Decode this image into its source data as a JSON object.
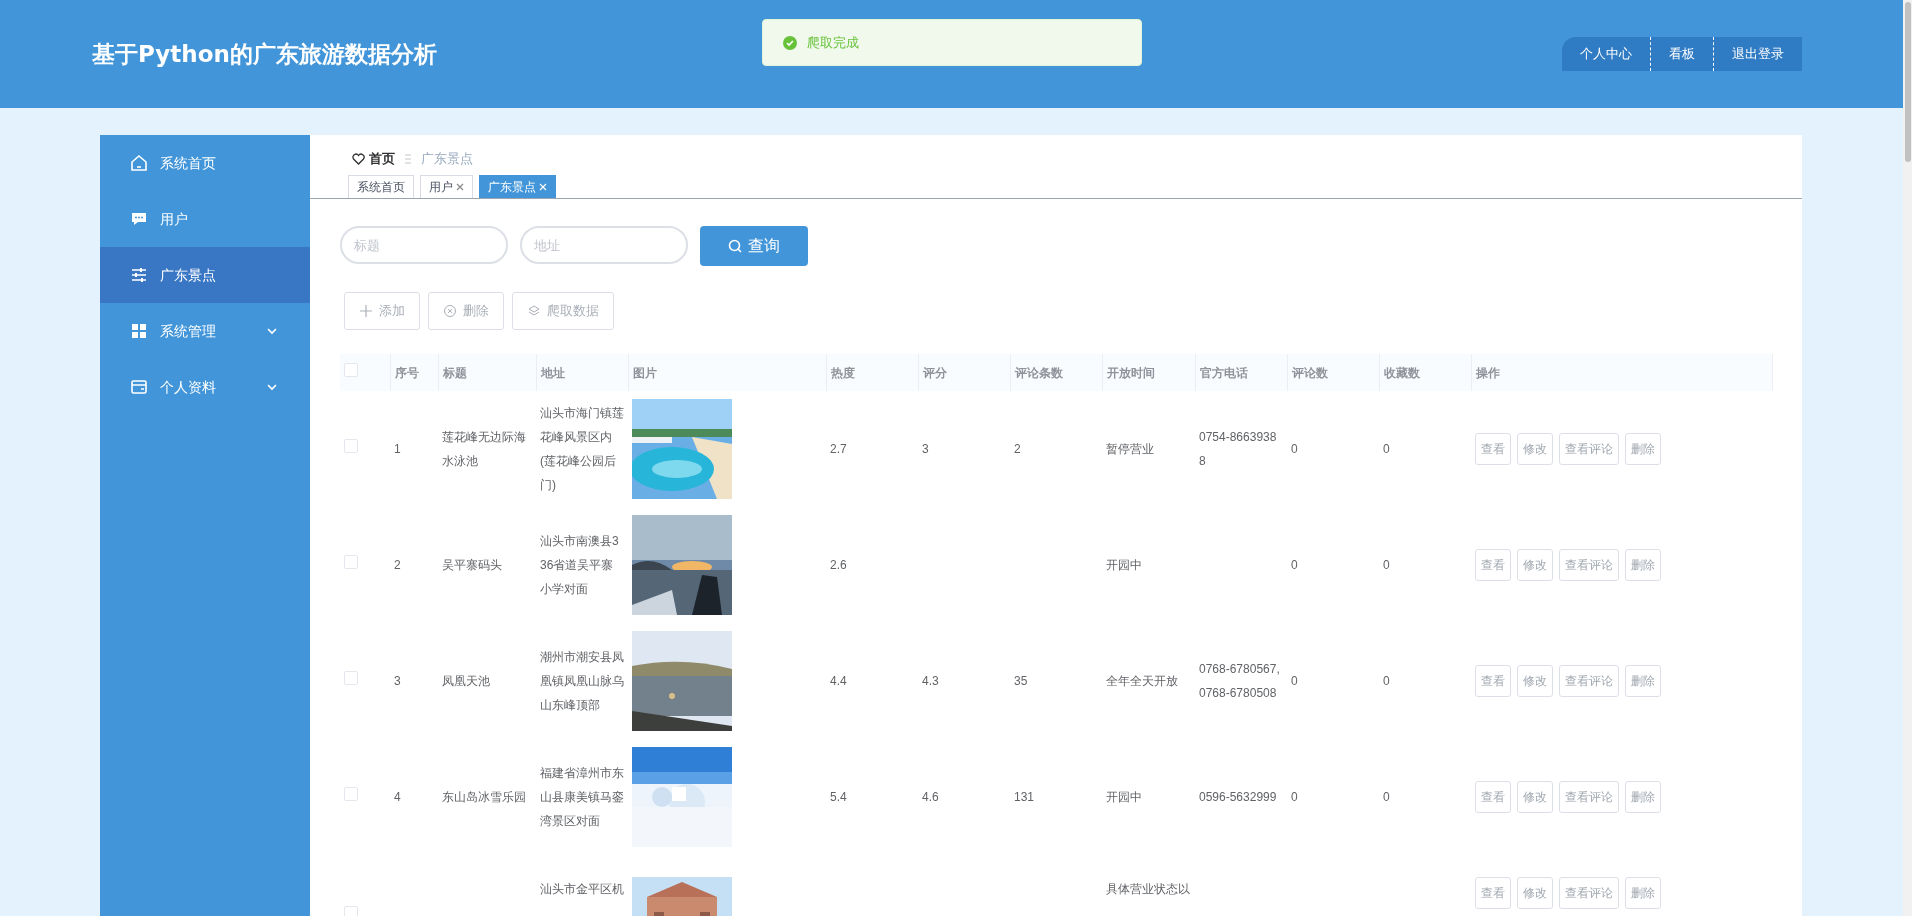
{
  "header": {
    "title": "基于Python的广东旅游数据分析",
    "nav": [
      "个人中心",
      "看板",
      "退出登录"
    ]
  },
  "toast": {
    "message": "爬取完成"
  },
  "sidebar": {
    "items": [
      {
        "label": "系统首页",
        "selected": false,
        "expandable": false
      },
      {
        "label": "用户",
        "selected": false,
        "expandable": false
      },
      {
        "label": "广东景点",
        "selected": true,
        "expandable": false
      },
      {
        "label": "系统管理",
        "selected": false,
        "expandable": true
      },
      {
        "label": "个人资料",
        "selected": false,
        "expandable": true
      }
    ]
  },
  "breadcrumb": [
    "首页",
    "广东景点"
  ],
  "tabs": [
    {
      "label": "系统首页",
      "selected": false,
      "closable": false
    },
    {
      "label": "用户",
      "selected": false,
      "closable": true
    },
    {
      "label": "广东景点",
      "selected": true,
      "closable": true
    }
  ],
  "search": {
    "fields": [
      {
        "placeholder": "标题"
      },
      {
        "placeholder": "地址"
      }
    ],
    "button": "查询"
  },
  "actions": [
    {
      "label": "添加"
    },
    {
      "label": "删除"
    },
    {
      "label": "爬取数据"
    }
  ],
  "table": {
    "select_all": {
      "checked": false
    },
    "columns": [
      "序号",
      "标题",
      "地址",
      "图片",
      "热度",
      "评分",
      "评论条数",
      "开放时间",
      "官方电话",
      "评论数",
      "收藏数",
      "操作"
    ],
    "rows": [
      {
        "checked": false,
        "index": "1",
        "title": "莲花峰无边际海水泳池",
        "address": "汕头市海门镇莲花峰风景区内(莲花峰公园后门)",
        "picture": {
          "kind": "picture"
        },
        "heat": "2.7",
        "score": "3",
        "comment_count": "2",
        "open_time": "暂停营业",
        "phone": "0754-86639388",
        "reviews": "0",
        "favorites": "0",
        "buttons": [
          "查看",
          "修改",
          "查看评论",
          "删除"
        ]
      },
      {
        "checked": false,
        "index": "2",
        "title": "吴平寨码头",
        "address": "汕头市南澳县336省道吴平寨小学对面",
        "picture": {
          "kind": "picture"
        },
        "heat": "2.6",
        "open_time": "开园中",
        "reviews": "0",
        "favorites": "0",
        "buttons": [
          "查看",
          "修改",
          "查看评论",
          "删除"
        ]
      },
      {
        "checked": false,
        "index": "3",
        "title": "凤凰天池",
        "address": "潮州市潮安县凤凰镇凤凰山脉乌山东峰顶部",
        "picture": {
          "kind": "picture"
        },
        "heat": "4.4",
        "score": "4.3",
        "comment_count": "35",
        "open_time": "全年全天开放",
        "phone": "0768-6780567,0768-6780508",
        "reviews": "0",
        "favorites": "0",
        "buttons": [
          "查看",
          "修改",
          "查看评论",
          "删除"
        ]
      },
      {
        "checked": false,
        "index": "4",
        "title": "东山岛冰雪乐园",
        "address": "福建省漳州市东山县康美镇马銮湾景区对面",
        "picture": {
          "kind": "picture"
        },
        "heat": "5.4",
        "score": "4.6",
        "comment_count": "131",
        "open_time": "开园中",
        "phone": "0596-5632999",
        "reviews": "0",
        "favorites": "0",
        "buttons": [
          "查看",
          "修改",
          "查看评论",
          "删除"
        ]
      },
      {
        "checked": false,
        "address": "汕头市金平区机",
        "picture": {
          "kind": "picture"
        },
        "open_time": "具体营业状态以",
        "buttons": [
          "查看",
          "修改",
          "查看评论",
          "删除"
        ]
      }
    ]
  }
}
